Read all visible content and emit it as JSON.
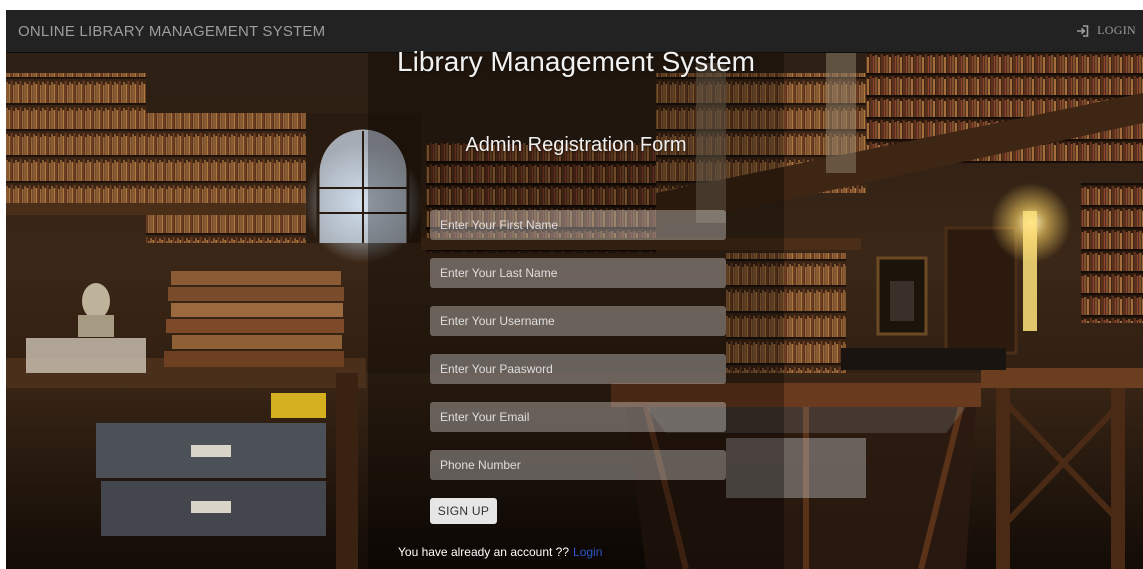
{
  "navbar": {
    "brand": "ONLINE LIBRARY MANAGEMENT SYSTEM",
    "login_icon": "login-icon",
    "login_label": "LOGIN"
  },
  "heading": {
    "title": "Library Management System",
    "subtitle": "Admin Registration Form"
  },
  "form": {
    "first_name_placeholder": "Enter Your First Name",
    "last_name_placeholder": "Enter Your Last Name",
    "username_placeholder": "Enter Your Username",
    "password_placeholder": "Enter Your Paasword",
    "email_placeholder": "Enter Your Email",
    "phone_placeholder": "Phone Number",
    "first_name_value": "",
    "last_name_value": "",
    "username_value": "",
    "password_value": "",
    "email_value": "",
    "phone_value": "",
    "signup_label": "SIGN UP"
  },
  "footer": {
    "question": "You have already an account ??",
    "login_link": "Login"
  },
  "colors": {
    "navbar_bg": "#222222",
    "navbar_text": "#9d9d9d",
    "link": "#2a56c6"
  }
}
